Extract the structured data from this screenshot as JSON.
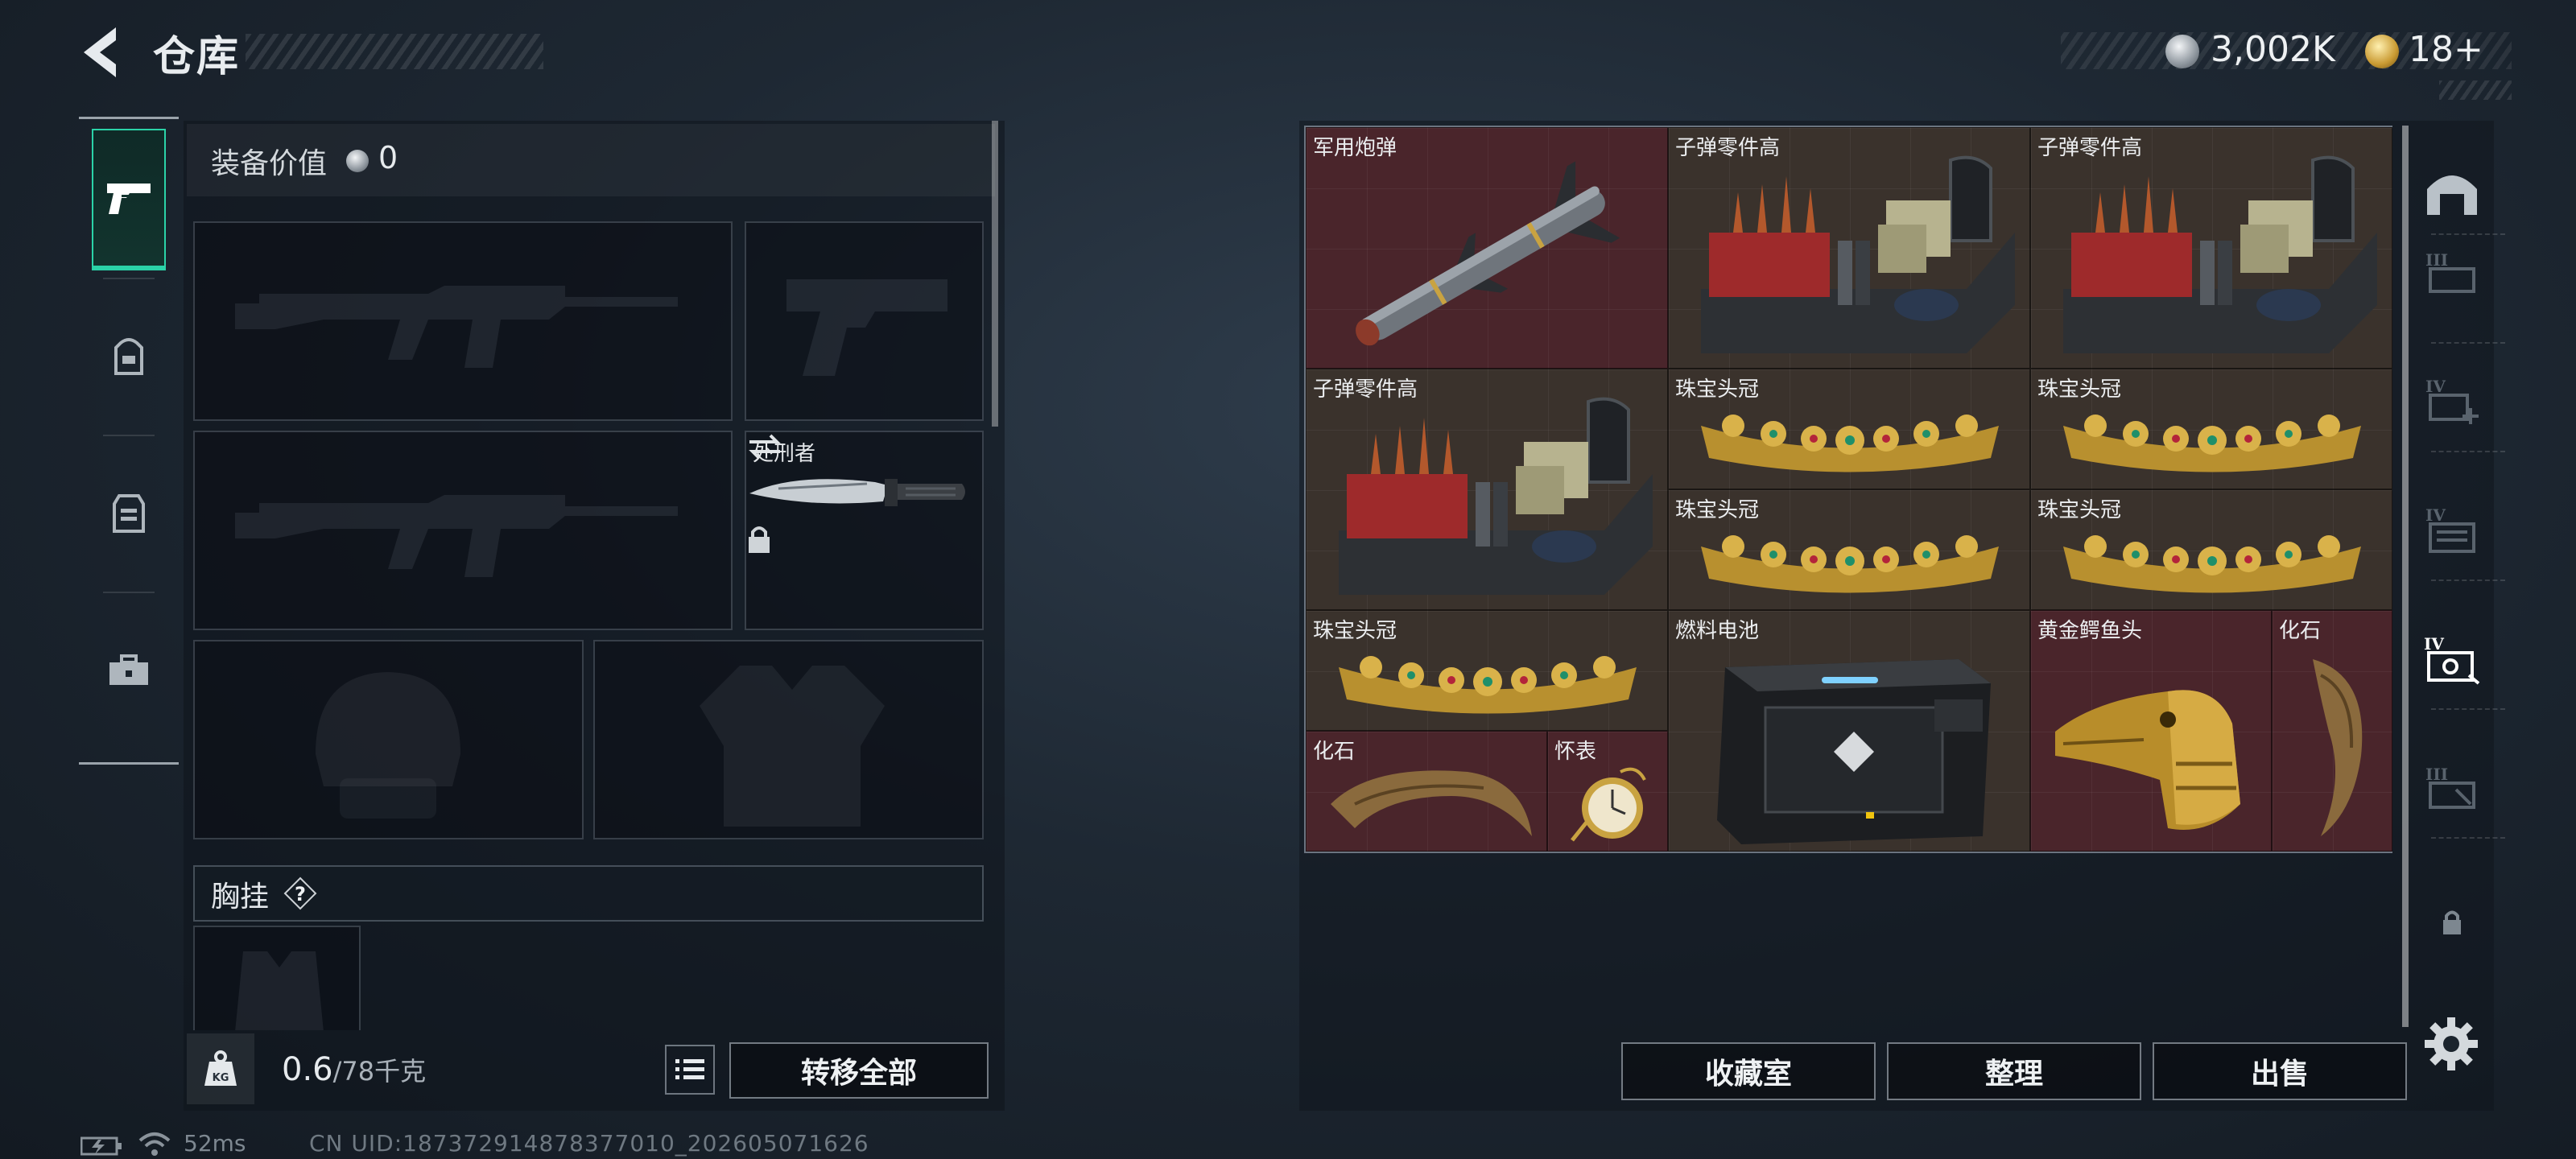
{
  "header": {
    "title": "仓库",
    "money": "3,002K",
    "tickets": "18+"
  },
  "sidebar_categories": [
    {
      "name": "weapons",
      "icon": "pistol-icon",
      "active": true
    },
    {
      "name": "armor",
      "icon": "backpack-icon",
      "active": false
    },
    {
      "name": "chest-rig",
      "icon": "vest-icon",
      "active": false
    },
    {
      "name": "supplies",
      "icon": "toolbox-icon",
      "active": false
    }
  ],
  "loadout": {
    "equip_value_label": "装备价值",
    "equip_value": "0",
    "melee_label": "处刑者",
    "chest_rig_label": "胸挂",
    "chest_rig_help": "?",
    "weight_current": "0.6",
    "weight_max": "/78千克",
    "transfer_all_label": "转移全部"
  },
  "storage": {
    "items": [
      {
        "label": "军用炮弹",
        "icon": "missile-icon",
        "bg": "#4a252b"
      },
      {
        "label": "子弹零件高",
        "icon": "ammo-crate-icon",
        "bg": "#3a322c"
      },
      {
        "label": "子弹零件高",
        "icon": "ammo-crate-icon",
        "bg": "#3a322c"
      },
      {
        "label": "子弹零件高",
        "icon": "ammo-crate-icon",
        "bg": "#3a322c"
      },
      {
        "label": "珠宝头冠",
        "icon": "tiara-icon",
        "bg": "#3a322c"
      },
      {
        "label": "珠宝头冠",
        "icon": "tiara-icon",
        "bg": "#3a322c"
      },
      {
        "label": "珠宝头冠",
        "icon": "tiara-icon",
        "bg": "#3a322c"
      },
      {
        "label": "珠宝头冠",
        "icon": "tiara-icon",
        "bg": "#3a322c"
      },
      {
        "label": "珠宝头冠",
        "icon": "tiara-icon",
        "bg": "#3a322c"
      },
      {
        "label": "燃料电池",
        "icon": "fuel-cell-icon",
        "bg": "#3a322c"
      },
      {
        "label": "黄金鳄鱼头",
        "icon": "gold-croc-head-icon",
        "bg": "#4a252b"
      },
      {
        "label": "化石",
        "icon": "fossil-claw-icon",
        "bg": "#4a252b"
      },
      {
        "label": "化石",
        "icon": "fossil-claw-icon",
        "bg": "#4a252b"
      },
      {
        "label": "怀表",
        "icon": "pocket-watch-icon",
        "bg": "#4a252b"
      }
    ],
    "buttons": {
      "collection": "收藏室",
      "organize": "整理",
      "sell": "出售"
    }
  },
  "status_bar": {
    "ping": "52ms",
    "uid": "CN UID:187372914878377010_202605071626"
  },
  "colors": {
    "accent": "#2bd3a8",
    "rare_bg": "#4a252b",
    "common_bg": "#3a322c"
  }
}
